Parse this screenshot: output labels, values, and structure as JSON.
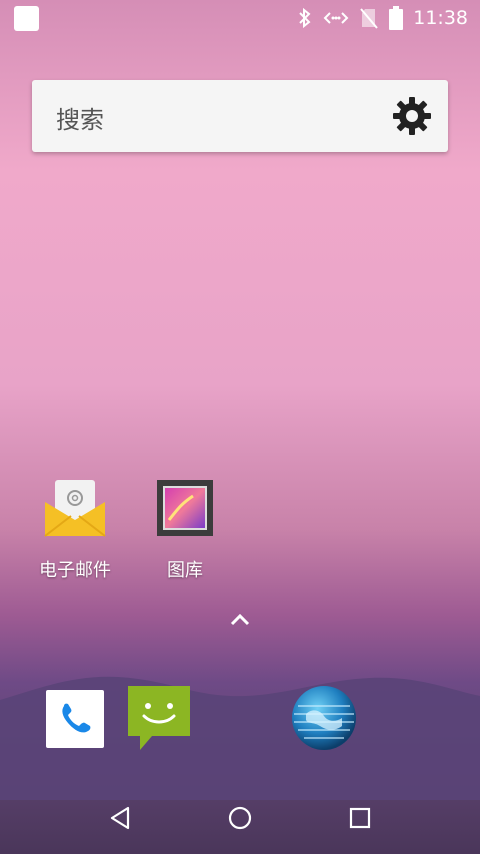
{
  "status_bar": {
    "time": "11:38",
    "icons": [
      "notification-square-icon",
      "bluetooth-icon",
      "data-transfer-icon",
      "no-sim-icon",
      "battery-icon"
    ]
  },
  "search": {
    "placeholder": "搜索",
    "settings_icon": "gear-icon"
  },
  "apps": [
    {
      "label": "电子邮件",
      "icon": "email-icon"
    },
    {
      "label": "图库",
      "icon": "gallery-icon"
    }
  ],
  "dock": [
    {
      "icon": "phone-icon"
    },
    {
      "icon": "messaging-icon"
    },
    {
      "icon": "browser-globe-icon"
    }
  ],
  "navigation": [
    "back-icon",
    "home-icon",
    "recents-icon"
  ],
  "colors": {
    "search_bg": "#f5f5f5",
    "email_yellow": "#f5c025",
    "messaging_green": "#8cb623",
    "phone_blue": "#1a88e8"
  }
}
